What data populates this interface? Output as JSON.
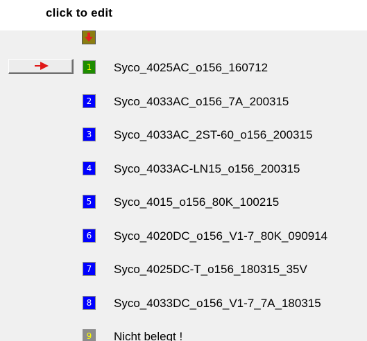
{
  "header": {
    "title": "click to edit",
    "icon": "download-arrow-icon",
    "icon_colors": {
      "background": "#8b7d10",
      "arrow": "#e02020"
    }
  },
  "select_button": {
    "icon": "right-arrow-icon",
    "arrow_color": "#e01818"
  },
  "colors": {
    "panel_background": "#f0f0f0",
    "header_background": "#ffffff",
    "active_badge": "#1e8c00",
    "active_badge_text": "#ffff00",
    "occupied_badge": "#0000ff",
    "occupied_badge_text": "#ffffff",
    "empty_badge": "#8c8c8c",
    "empty_badge_text": "#ffff00"
  },
  "profiles": [
    {
      "slot": "1",
      "name": "Syco_4025AC_o156_160712",
      "state": "active"
    },
    {
      "slot": "2",
      "name": "Syco_4033AC_o156_7A_200315",
      "state": "occupied"
    },
    {
      "slot": "3",
      "name": "Syco_4033AC_2ST-60_o156_200315",
      "state": "occupied"
    },
    {
      "slot": "4",
      "name": "Syco_4033AC-LN15_o156_200315",
      "state": "occupied"
    },
    {
      "slot": "5",
      "name": "Syco_4015_o156_80K_100215",
      "state": "occupied"
    },
    {
      "slot": "6",
      "name": "Syco_4020DC_o156_V1-7_80K_090914",
      "state": "occupied"
    },
    {
      "slot": "7",
      "name": "Syco_4025DC-T_o156_180315_35V",
      "state": "occupied"
    },
    {
      "slot": "8",
      "name": "Syco_4033DC_o156_V1-7_7A_180315",
      "state": "occupied"
    },
    {
      "slot": "9",
      "name": "Nicht belegt !",
      "state": "empty"
    }
  ]
}
